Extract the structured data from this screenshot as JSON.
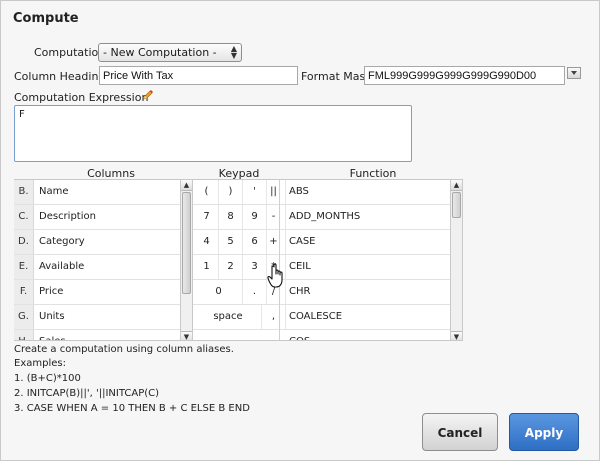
{
  "dialog": {
    "title": "Compute"
  },
  "computation": {
    "label": "Computation",
    "selected": "- New Computation -"
  },
  "heading": {
    "label": "Column Heading",
    "value": "Price With Tax"
  },
  "format_mask": {
    "label": "Format Mask",
    "value": "FML999G999G999G999G990D00"
  },
  "expression": {
    "label": "Computation Expression",
    "value": "F"
  },
  "columns": {
    "header": "Columns",
    "items": [
      {
        "letter": "B.",
        "name": "Name"
      },
      {
        "letter": "C.",
        "name": "Description"
      },
      {
        "letter": "D.",
        "name": "Category"
      },
      {
        "letter": "E.",
        "name": "Available"
      },
      {
        "letter": "F.",
        "name": "Price"
      },
      {
        "letter": "G.",
        "name": "Units"
      },
      {
        "letter": "H.",
        "name": "Sales"
      }
    ]
  },
  "keypad": {
    "header": "Keypad",
    "rows": [
      [
        "(",
        ")",
        "'",
        "||"
      ],
      [
        "7",
        "8",
        "9",
        "-"
      ],
      [
        "4",
        "5",
        "6",
        "+"
      ],
      [
        "1",
        "2",
        "3",
        "*"
      ],
      [
        "0",
        ".",
        "/"
      ],
      [
        "space",
        ","
      ]
    ]
  },
  "functions": {
    "header": "Function",
    "items": [
      "ABS",
      "ADD_MONTHS",
      "CASE",
      "CEIL",
      "CHR",
      "COALESCE",
      "COS"
    ]
  },
  "help": {
    "intro": "Create a computation using column aliases.",
    "examples_label": "Examples:",
    "examples": [
      "1. (B+C)*100",
      "2. INITCAP(B)||', '||INITCAP(C)",
      "3. CASE WHEN A = 10 THEN B + C ELSE B END"
    ]
  },
  "buttons": {
    "cancel": "Cancel",
    "apply": "Apply"
  },
  "icons": {
    "select_arrows": "up-down-arrows-icon",
    "pencil": "pencil-icon",
    "mask_dropdown": "dropdown-arrow-icon",
    "scroll_up": "scroll-up-icon",
    "scroll_down": "scroll-down-icon",
    "cursor": "hand-pointer-icon"
  },
  "colors": {
    "apply_bg": "#3a7bd0",
    "expression_border": "#7aa0cf"
  }
}
